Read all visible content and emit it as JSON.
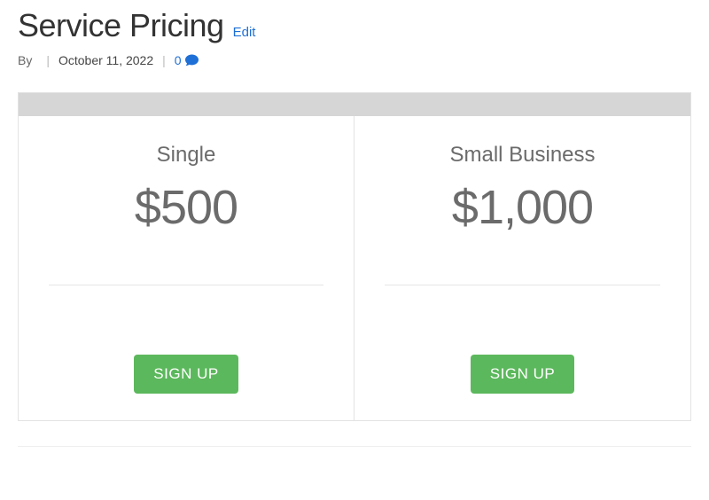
{
  "header": {
    "title": "Service Pricing",
    "edit_label": "Edit",
    "meta": {
      "by_label": "By",
      "author": "",
      "date": "October 11, 2022",
      "comments_count": "0"
    }
  },
  "plans": [
    {
      "name": "Single",
      "price": "$500",
      "cta": "SIGN UP"
    },
    {
      "name": "Small Business",
      "price": "$1,000",
      "cta": "SIGN UP"
    }
  ]
}
